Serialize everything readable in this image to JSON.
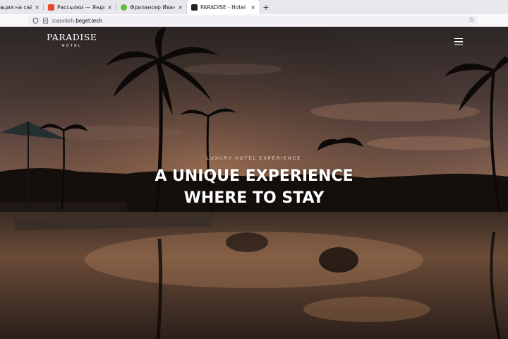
{
  "browser": {
    "tabs": [
      {
        "title": "ация на сайте",
        "favicon_color": null
      },
      {
        "title": "Рассылки — Яндекс Про",
        "favicon_color": "#e8472b"
      },
      {
        "title": "Фрилансер Иван Хабиб",
        "favicon_color": "#5cbf3a"
      },
      {
        "title": "PARADISE - Hotel and Be",
        "favicon_color": "#222222"
      }
    ],
    "close_glyph": "×",
    "new_tab_glyph": "+",
    "url_prefix": "ioannbrh.",
    "url_domain": "beget.tech",
    "star_glyph": "☆"
  },
  "site": {
    "logo_main": "PARADISE",
    "logo_sub": "HOTEL",
    "menu_icon": "hamburger-menu-icon",
    "eyebrow": "LUXURY HOTEL EXPERIENCE",
    "headline_line1": "A UNIQUE EXPERIENCE",
    "headline_line2": "WHERE TO STAY"
  },
  "colors": {
    "tab_strip": "#e8e8ec",
    "address_bar": "#f9f9fb",
    "text_on_hero": "#ffffff"
  }
}
